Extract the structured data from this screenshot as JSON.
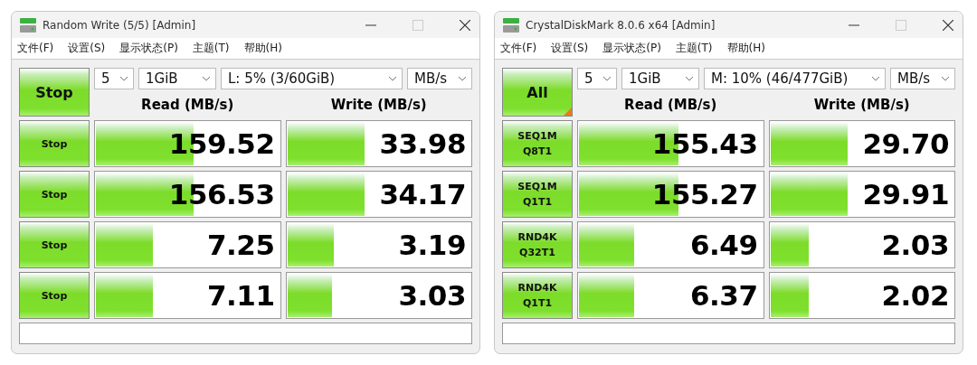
{
  "windows": [
    {
      "title": "Random Write (5/5) [Admin]",
      "menu": [
        "文件(F)",
        "设置(S)",
        "显示状态(P)",
        "主题(T)",
        "帮助(H)"
      ],
      "main_button": "Stop",
      "corner_mark": false,
      "count": "5",
      "size": "1GiB",
      "drive": "L: 5% (3/60GiB)",
      "unit": "MB/s",
      "read_header": "Read (MB/s)",
      "write_header": "Write (MB/s)",
      "rows": [
        {
          "label": [
            "Stop"
          ],
          "read": {
            "value": "159.52",
            "level": 0.53
          },
          "write": {
            "value": "33.98",
            "level": 0.42
          }
        },
        {
          "label": [
            "Stop"
          ],
          "read": {
            "value": "156.53",
            "level": 0.53
          },
          "write": {
            "value": "34.17",
            "level": 0.42
          }
        },
        {
          "label": [
            "Stop"
          ],
          "read": {
            "value": "7.25",
            "level": 0.31
          },
          "write": {
            "value": "3.19",
            "level": 0.25
          }
        },
        {
          "label": [
            "Stop"
          ],
          "read": {
            "value": "7.11",
            "level": 0.31
          },
          "write": {
            "value": "3.03",
            "level": 0.24
          }
        }
      ]
    },
    {
      "title": "CrystalDiskMark 8.0.6 x64 [Admin]",
      "menu": [
        "文件(F)",
        "设置(S)",
        "显示状态(P)",
        "主题(T)",
        "帮助(H)"
      ],
      "main_button": "All",
      "corner_mark": true,
      "count": "5",
      "size": "1GiB",
      "drive": "M: 10% (46/477GiB)",
      "unit": "MB/s",
      "read_header": "Read (MB/s)",
      "write_header": "Write (MB/s)",
      "rows": [
        {
          "label": [
            "SEQ1M",
            "Q8T1"
          ],
          "read": {
            "value": "155.43",
            "level": 0.54
          },
          "write": {
            "value": "29.70",
            "level": 0.42
          }
        },
        {
          "label": [
            "SEQ1M",
            "Q1T1"
          ],
          "read": {
            "value": "155.27",
            "level": 0.54
          },
          "write": {
            "value": "29.91",
            "level": 0.42
          }
        },
        {
          "label": [
            "RND4K",
            "Q32T1"
          ],
          "read": {
            "value": "6.49",
            "level": 0.3
          },
          "write": {
            "value": "2.03",
            "level": 0.21
          }
        },
        {
          "label": [
            "RND4K",
            "Q1T1"
          ],
          "read": {
            "value": "6.37",
            "level": 0.3
          },
          "write": {
            "value": "2.02",
            "level": 0.21
          }
        }
      ]
    }
  ]
}
